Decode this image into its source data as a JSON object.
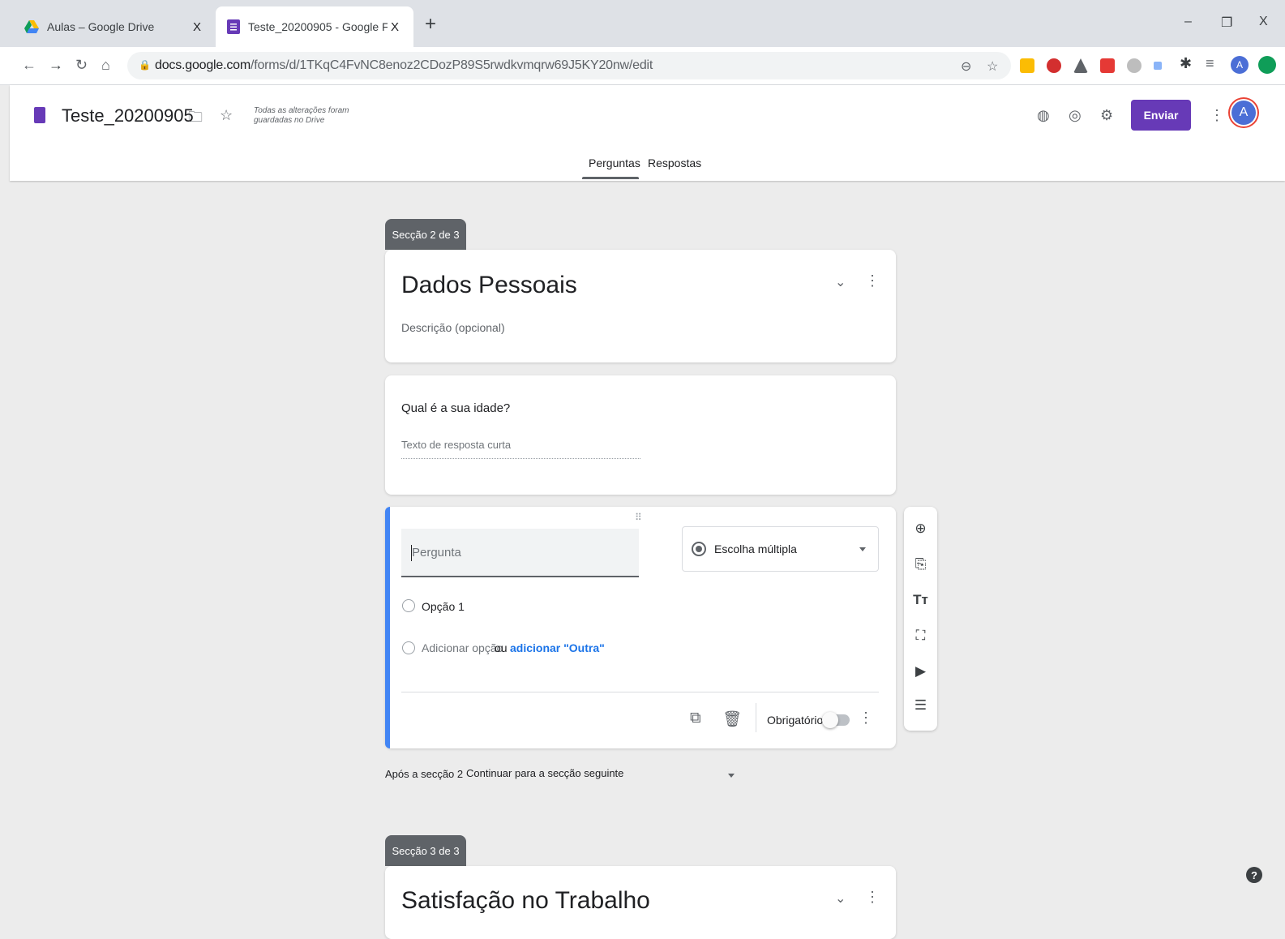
{
  "browser": {
    "tabs": [
      {
        "title": "Aulas – Google Drive",
        "close": "X"
      },
      {
        "title": "Teste_20200905 - Google Forms",
        "close": "X"
      }
    ],
    "new_tab": "+",
    "window": {
      "minimize": "–",
      "maximize": "❐",
      "close": "X"
    },
    "url_host": "docs.google.com",
    "url_path": "/forms/d/1TKqC4FvNC8enoz2CDozP89S5rwdkvmqrw69J5KY20nw/edit",
    "profile_initial": "A"
  },
  "header": {
    "doc_title": "Teste_20200905",
    "saved_status_line1": "Todas as alterações foram",
    "saved_status_line2": "guardadas no Drive",
    "send_label": "Enviar",
    "avatar_initial": "A",
    "tabs": {
      "questions": "Perguntas",
      "responses": "Respostas"
    }
  },
  "section2": {
    "label": "Secção 2 de 3",
    "title": "Dados Pessoais",
    "description": "Descrição (opcional)"
  },
  "question1": {
    "title": "Qual é a sua idade?",
    "answer_placeholder": "Texto de resposta curta"
  },
  "question2": {
    "title_placeholder": "Pergunta",
    "type": "Escolha múltipla",
    "option1": "Opção 1",
    "add_option": "Adicionar opção",
    "or": "ou",
    "add_other": "adicionar \"Outra\"",
    "required_label": "Obrigatório",
    "required": false
  },
  "after_section": {
    "label": "Após a secção 2",
    "value": "Continuar para a secção seguinte"
  },
  "section3": {
    "label": "Secção 3 de 3",
    "title": "Satisfação no Trabalho"
  },
  "help": "?",
  "colors": {
    "accent": "#673ab7",
    "active_question": "#4285f4",
    "link": "#1a73e8"
  }
}
